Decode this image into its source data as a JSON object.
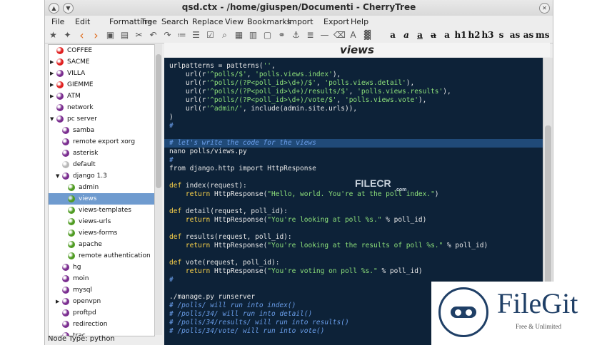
{
  "window": {
    "title": "qsd.ctx - /home/giuspen/Documenti - CherryTree",
    "status": "Node Type: python"
  },
  "menu": [
    "File",
    "Edit",
    "Formatting",
    "Tree",
    "Search",
    "Replace",
    "View",
    "Bookmarks",
    "Import",
    "Export",
    "Help"
  ],
  "toolbar": {
    "icons": [
      "add-node-icon",
      "add-subnode-icon",
      "go-back-icon",
      "go-forward-icon",
      "save-icon",
      "export-pdf-icon",
      "cut-icon",
      "undo-icon",
      "redo-icon",
      "bulleted-list-icon",
      "numbered-list-icon",
      "todo-list-icon",
      "find-icon",
      "insert-image-icon",
      "insert-table-icon",
      "insert-codebox-icon",
      "insert-link-icon",
      "insert-anchor-icon",
      "insert-toc-icon",
      "horizontal-rule-icon",
      "clear-format-icon",
      "color-fg-icon",
      "color-bg-icon"
    ],
    "format_buttons": [
      "a",
      "a",
      "a",
      "a",
      "a",
      "h1",
      "h2",
      "h3",
      "s",
      "as",
      "as",
      "ms"
    ]
  },
  "tree": [
    {
      "label": "COFFEE",
      "color": "#e02020",
      "expander": "",
      "level": 0
    },
    {
      "label": "SACME",
      "color": "#e02020",
      "expander": "right",
      "level": 0
    },
    {
      "label": "VILLA",
      "color": "#7a2d8f",
      "expander": "right",
      "level": 0
    },
    {
      "label": "GIEMME",
      "color": "#e02020",
      "expander": "right",
      "level": 0
    },
    {
      "label": "ATM",
      "color": "#7a2d8f",
      "expander": "right",
      "level": 0
    },
    {
      "label": "network",
      "color": "#7a2d8f",
      "expander": "",
      "level": 0
    },
    {
      "label": "pc server",
      "color": "#7a2d8f",
      "expander": "down",
      "level": 0
    },
    {
      "label": "samba",
      "color": "#7a2d8f",
      "expander": "",
      "level": 1
    },
    {
      "label": "remote export xorg",
      "color": "#7a2d8f",
      "expander": "",
      "level": 1
    },
    {
      "label": "asterisk",
      "color": "#7a2d8f",
      "expander": "",
      "level": 1
    },
    {
      "label": "default",
      "color": "#b8b8b8",
      "expander": "",
      "level": 1
    },
    {
      "label": "django 1.3",
      "color": "#7a2d8f",
      "expander": "down",
      "level": 1
    },
    {
      "label": "admin",
      "color": "#4f9b22",
      "expander": "",
      "level": 2
    },
    {
      "label": "views",
      "color": "#4f9b22",
      "expander": "",
      "level": 2,
      "selected": true
    },
    {
      "label": "views-templates",
      "color": "#4f9b22",
      "expander": "",
      "level": 2
    },
    {
      "label": "views-urls",
      "color": "#4f9b22",
      "expander": "",
      "level": 2
    },
    {
      "label": "views-forms",
      "color": "#4f9b22",
      "expander": "",
      "level": 2
    },
    {
      "label": "apache",
      "color": "#4f9b22",
      "expander": "",
      "level": 2
    },
    {
      "label": "remote authentication",
      "color": "#4f9b22",
      "expander": "",
      "level": 2
    },
    {
      "label": "hg",
      "color": "#7a2d8f",
      "expander": "",
      "level": 1
    },
    {
      "label": "moin",
      "color": "#7a2d8f",
      "expander": "",
      "level": 1
    },
    {
      "label": "mysql",
      "color": "#7a2d8f",
      "expander": "",
      "level": 1
    },
    {
      "label": "openvpn",
      "color": "#7a2d8f",
      "expander": "right",
      "level": 1
    },
    {
      "label": "proftpd",
      "color": "#7a2d8f",
      "expander": "",
      "level": 1
    },
    {
      "label": "redirection",
      "color": "#7a2d8f",
      "expander": "",
      "level": 1
    },
    {
      "label": "trac",
      "color": "#7a2d8f",
      "expander": "",
      "level": 1
    }
  ],
  "editor": {
    "node_title": "views",
    "lines": [
      [
        [
          "pl",
          "urlpatterns = patterns("
        ],
        [
          "str",
          "''"
        ],
        [
          "pl",
          ","
        ]
      ],
      [
        [
          "pl",
          "    url(r"
        ],
        [
          "str",
          "'^polls/$'"
        ],
        [
          "pl",
          ", "
        ],
        [
          "str",
          "'polls.views.index'"
        ],
        [
          "pl",
          "),"
        ]
      ],
      [
        [
          "pl",
          "    url(r"
        ],
        [
          "str",
          "'^polls/(?P<poll_id>\\d+)/$'"
        ],
        [
          "pl",
          ", "
        ],
        [
          "str",
          "'polls.views.detail'"
        ],
        [
          "pl",
          "),"
        ]
      ],
      [
        [
          "pl",
          "    url(r"
        ],
        [
          "str",
          "'^polls/(?P<poll_id>\\d+)/results/$'"
        ],
        [
          "pl",
          ", "
        ],
        [
          "str",
          "'polls.views.results'"
        ],
        [
          "pl",
          "),"
        ]
      ],
      [
        [
          "pl",
          "    url(r"
        ],
        [
          "str",
          "'^polls/(?P<poll_id>\\d+)/vote/$'"
        ],
        [
          "pl",
          ", "
        ],
        [
          "str",
          "'polls.views.vote'"
        ],
        [
          "pl",
          "),"
        ]
      ],
      [
        [
          "pl",
          "    url(r"
        ],
        [
          "str",
          "'^admin/'"
        ],
        [
          "pl",
          ", include(admin.site.urls)),"
        ]
      ],
      [
        [
          "pl",
          ")"
        ]
      ],
      [
        [
          "com",
          "#"
        ]
      ],
      [
        [
          "pl",
          ""
        ]
      ],
      [
        [
          "com",
          "# let's write the code for the views"
        ]
      ],
      [
        [
          "pl",
          "nano polls/views.py"
        ]
      ],
      [
        [
          "com",
          "#"
        ]
      ],
      [
        [
          "pl",
          "from django.http import HttpResponse"
        ]
      ],
      [
        [
          "pl",
          ""
        ]
      ],
      [
        [
          "def",
          "def"
        ],
        [
          "pl",
          " index(request):"
        ]
      ],
      [
        [
          "pl",
          "    "
        ],
        [
          "def",
          "return"
        ],
        [
          "pl",
          " HttpResponse("
        ],
        [
          "str",
          "\"Hello, world. You're at the poll index.\""
        ],
        [
          "pl",
          ")"
        ]
      ],
      [
        [
          "pl",
          ""
        ]
      ],
      [
        [
          "def",
          "def"
        ],
        [
          "pl",
          " detail(request, poll_id):"
        ]
      ],
      [
        [
          "pl",
          "    "
        ],
        [
          "def",
          "return"
        ],
        [
          "pl",
          " HttpResponse("
        ],
        [
          "str",
          "\"You're looking at poll %s.\""
        ],
        [
          "pl",
          " % poll_id)"
        ]
      ],
      [
        [
          "pl",
          ""
        ]
      ],
      [
        [
          "def",
          "def"
        ],
        [
          "pl",
          " results(request, poll_id):"
        ]
      ],
      [
        [
          "pl",
          "    "
        ],
        [
          "def",
          "return"
        ],
        [
          "pl",
          " HttpResponse("
        ],
        [
          "str",
          "\"You're looking at the results of poll %s.\""
        ],
        [
          "pl",
          " % poll_id)"
        ]
      ],
      [
        [
          "pl",
          ""
        ]
      ],
      [
        [
          "def",
          "def"
        ],
        [
          "pl",
          " vote(request, poll_id):"
        ]
      ],
      [
        [
          "pl",
          "    "
        ],
        [
          "def",
          "return"
        ],
        [
          "pl",
          " HttpResponse("
        ],
        [
          "str",
          "\"You're voting on poll %s.\""
        ],
        [
          "pl",
          " % poll_id)"
        ]
      ],
      [
        [
          "com",
          "#"
        ]
      ],
      [
        [
          "pl",
          ""
        ]
      ],
      [
        [
          "pl",
          "./manage.py runserver"
        ]
      ],
      [
        [
          "com",
          "# /polls/ will run into index()"
        ]
      ],
      [
        [
          "com",
          "# /polls/34/ will run into detail()"
        ]
      ],
      [
        [
          "com",
          "# /polls/34/results/ will run into results()"
        ]
      ],
      [
        [
          "com",
          "# /polls/34/vote/ will run into vote()"
        ]
      ]
    ],
    "highlighted_line": 9
  },
  "overlays": {
    "watermark": "FILECR",
    "watermark_sub": ".com",
    "badge_name": "FileGit",
    "badge_sub": "Free & Unlimited"
  }
}
